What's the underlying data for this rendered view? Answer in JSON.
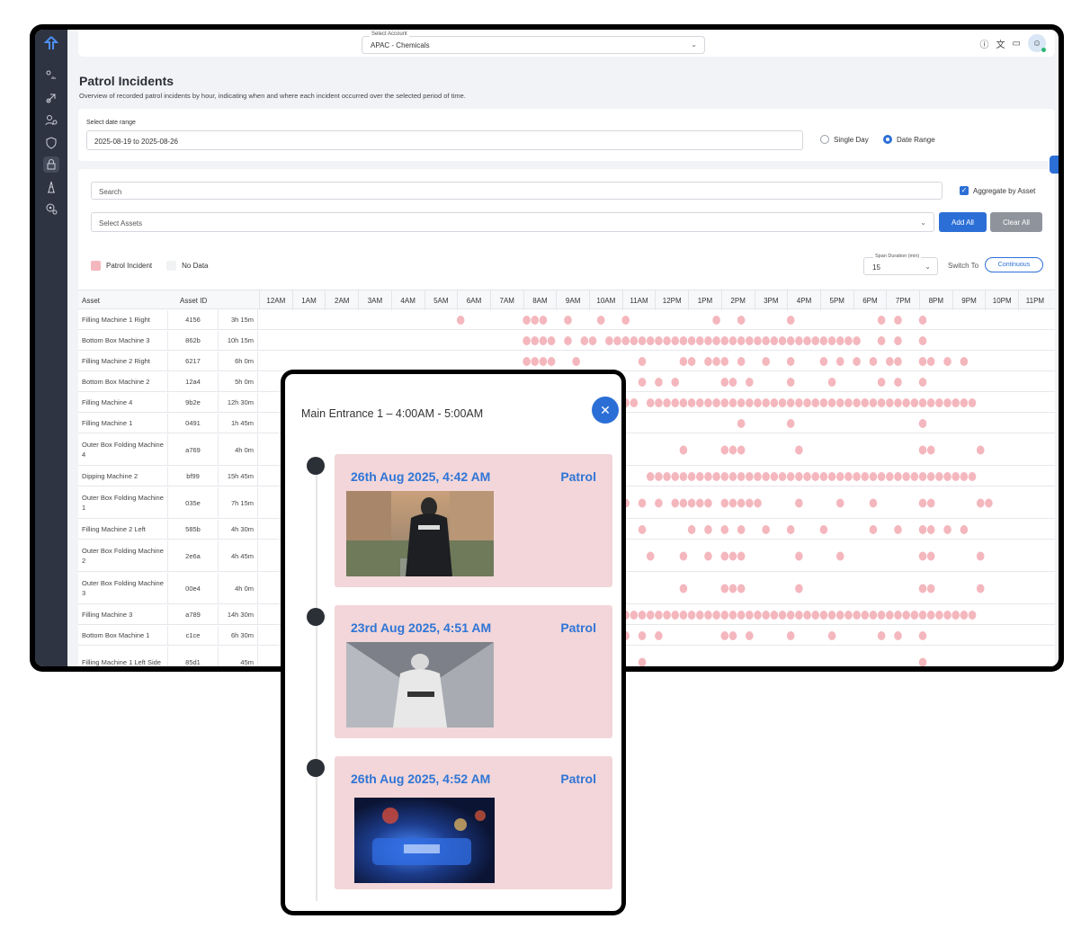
{
  "colors": {
    "accent": "#2b6fd6",
    "incident": "#f4b7bd",
    "nodata": "#f1f2f4",
    "sidebar": "#2e3441"
  },
  "topbar": {
    "account_label": "Select Account",
    "account_value": "APAC - Chemicals",
    "icons": [
      "help-icon",
      "translate-icon",
      "monitor-icon",
      "user-icon"
    ]
  },
  "page": {
    "title": "Patrol Incidents",
    "subtitle": "Overview of recorded patrol incidents by hour, indicating when and where each incident occurred over the selected period of time."
  },
  "date": {
    "label": "Select date range",
    "value": "2025-08-19 to 2025-08-26",
    "opt_single": "Single Day",
    "opt_range": "Date Range",
    "selected": "Date Range"
  },
  "filters": {
    "search_placeholder": "Search",
    "aggregate_label": "Aggregate by Asset",
    "assets_placeholder": "Select Assets",
    "add_all": "Add All",
    "clear_all": "Clear All"
  },
  "legend": {
    "incident": "Patrol Incident",
    "nodata": "No Data"
  },
  "span": {
    "label": "Span Duration (min)",
    "value": "15",
    "switch_label": "Switch To",
    "switch_btn": "Continuous"
  },
  "grid": {
    "col_asset": "Asset",
    "col_id": "Asset ID",
    "hours": [
      "12AM",
      "1AM",
      "2AM",
      "3AM",
      "4AM",
      "5AM",
      "6AM",
      "7AM",
      "8AM",
      "9AM",
      "10AM",
      "11AM",
      "12PM",
      "1PM",
      "2PM",
      "3PM",
      "4PM",
      "5PM",
      "6PM",
      "7PM",
      "8PM",
      "9PM",
      "10PM",
      "11PM"
    ],
    "rows": [
      {
        "asset": "Filling Machine 1 Right",
        "id": "4156",
        "dur": "3h 15m",
        "h": 22,
        "dots": [
          6.0,
          8.0,
          8.25,
          8.5,
          9.25,
          10.25,
          11.0,
          13.75,
          14.5,
          16.0,
          18.75,
          19.25,
          20.0
        ]
      },
      {
        "asset": "Bottom Box Machine 3",
        "id": "862b",
        "dur": "10h 15m",
        "h": 22,
        "dots": [
          8.0,
          8.25,
          8.5,
          8.75,
          9.25,
          9.75,
          10.0,
          "r:10.5:18.0",
          18.75,
          19.25,
          20.0
        ]
      },
      {
        "asset": "Filling Machine 2 Right",
        "id": "6217",
        "dur": "6h 0m",
        "h": 22,
        "dots": [
          8.0,
          8.25,
          8.5,
          8.75,
          9.5,
          11.5,
          12.75,
          13.0,
          13.5,
          13.75,
          14.0,
          14.5,
          15.25,
          16.0,
          17.0,
          17.5,
          18.0,
          18.5,
          19.0,
          19.25,
          20.0,
          20.25,
          20.75,
          21.25
        ]
      },
      {
        "asset": "Bottom Box Machine 2",
        "id": "12a4",
        "dur": "5h 0m",
        "h": 22,
        "dots": [
          11.5,
          12.0,
          12.5,
          14.0,
          14.25,
          14.75,
          16.0,
          17.25,
          18.75,
          19.25,
          20.0
        ]
      },
      {
        "asset": "Filling Machine 4",
        "id": "9b2e",
        "dur": "12h 30m",
        "h": 22,
        "dots": [
          11.0,
          11.25,
          "r:11.75:21.5"
        ]
      },
      {
        "asset": "Filling Machine 1",
        "id": "0491",
        "dur": "1h 45m",
        "h": 22,
        "dots": [
          14.5,
          16.0,
          20.0
        ]
      },
      {
        "asset": "Outer Box Folding Machine 4",
        "id": "a769",
        "dur": "4h 0m",
        "h": 35,
        "dots": [
          12.75,
          14.0,
          14.25,
          14.5,
          16.25,
          20.0,
          20.25,
          21.75
        ]
      },
      {
        "asset": "Dipping Machine 2",
        "id": "bf99",
        "dur": "15h 45m",
        "h": 22,
        "dots": [
          "r:11.75:21.5"
        ]
      },
      {
        "asset": "Outer Box Folding Machine 1",
        "id": "035e",
        "dur": "7h 15m",
        "h": 35,
        "dots": [
          11.0,
          11.5,
          12.0,
          12.5,
          12.75,
          13.0,
          13.25,
          13.5,
          14.0,
          14.25,
          14.5,
          14.75,
          15.0,
          16.25,
          17.5,
          18.5,
          20.0,
          20.25,
          21.75,
          22.0
        ]
      },
      {
        "asset": "Filling Machine 2 Left",
        "id": "585b",
        "dur": "4h 30m",
        "h": 22,
        "dots": [
          11.5,
          13.0,
          13.5,
          14.0,
          14.5,
          15.25,
          16.0,
          17.0,
          18.5,
          19.25,
          20.0,
          20.25,
          20.75,
          21.25
        ]
      },
      {
        "asset": "Outer Box Folding Machine 2",
        "id": "2e6a",
        "dur": "4h 45m",
        "h": 35,
        "dots": [
          11.75,
          12.75,
          13.5,
          14.0,
          14.25,
          14.5,
          16.25,
          17.5,
          20.0,
          20.25,
          21.75
        ]
      },
      {
        "asset": "Outer Box Folding Machine 3",
        "id": "00e4",
        "dur": "4h 0m",
        "h": 35,
        "dots": [
          12.75,
          14.0,
          14.25,
          14.5,
          16.25,
          20.0,
          20.25,
          21.75
        ]
      },
      {
        "asset": "Filling Machine 3",
        "id": "a789",
        "dur": "14h 30m",
        "h": 22,
        "dots": [
          "r:11.0:21.5"
        ]
      },
      {
        "asset": "Bottom Box Machine 1",
        "id": "c1ce",
        "dur": "6h 30m",
        "h": 22,
        "dots": [
          11.0,
          11.5,
          12.0,
          14.0,
          14.25,
          14.75,
          16.0,
          17.25,
          18.75,
          19.25,
          20.0
        ]
      },
      {
        "asset": "Filling Machine 1 Left Side",
        "id": "85d1",
        "dur": "45m",
        "h": 35,
        "dots": [
          11.5,
          20.0
        ]
      }
    ]
  },
  "popup": {
    "title": "Main Entrance 1 – 4:00AM - 5:00AM",
    "incidents": [
      {
        "date": "26th Aug 2025, 4:42 AM",
        "type": "Patrol"
      },
      {
        "date": "23rd Aug 2025, 4:51 AM",
        "type": "Patrol"
      },
      {
        "date": "26th Aug 2025, 4:52 AM",
        "type": "Patrol"
      }
    ]
  }
}
